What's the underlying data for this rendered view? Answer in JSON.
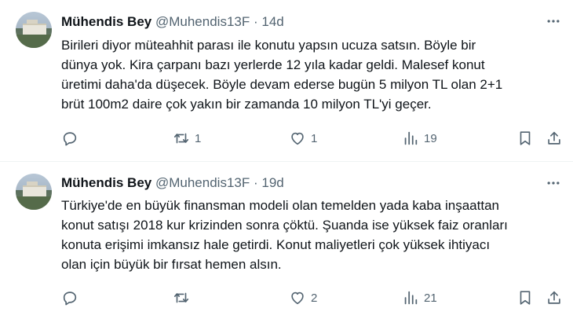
{
  "tweets": [
    {
      "name": "Mühendis Bey",
      "handle": "@Muhendis13F",
      "dot": "·",
      "time": "14d",
      "text": "Birileri diyor müteahhit parası ile konutu yapsın ucuza satsın. Böyle bir\ndünya yok. Kira çarpanı bazı yerlerde 12 yıla kadar geldi. Malesef konut\nüretimi daha'da düşecek. Böyle devam ederse bugün 5 milyon TL olan  2+1\nbrüt 100m2 daire çok yakın bir zamanda 10 milyon TL'yi geçer.",
      "reply_count": "",
      "retweet_count": "1",
      "like_count": "1",
      "view_count": "19"
    },
    {
      "name": "Mühendis Bey",
      "handle": "@Muhendis13F",
      "dot": "·",
      "time": "19d",
      "text": "Türkiye'de en büyük finansman modeli olan temelden yada kaba inşaattan\nkonut satışı 2018 kur krizinden sonra çöktü. Şuanda ise yüksek faiz oranları\nkonuta erişimi imkansız hale getirdi. Konut maliyetleri çok yüksek ihtiyacı\nolan için büyük bir fırsat hemen alsın.",
      "reply_count": "",
      "retweet_count": "",
      "like_count": "2",
      "view_count": "21"
    }
  ],
  "icons": {
    "reply": "reply-icon",
    "retweet": "retweet-icon",
    "like": "heart-icon",
    "views": "views-icon",
    "bookmark": "bookmark-icon",
    "share": "share-icon",
    "more": "more-icon"
  },
  "colors": {
    "text": "#0f1419",
    "secondary": "#536471",
    "divider": "#eff3f4"
  }
}
